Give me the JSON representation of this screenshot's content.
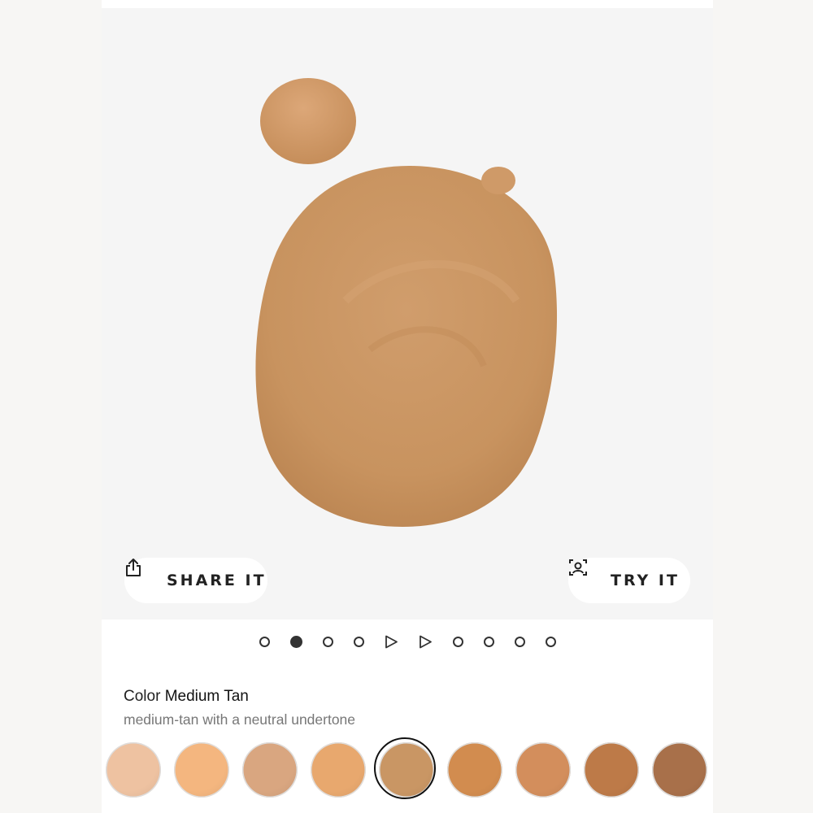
{
  "actions": {
    "share_label": "SHARE IT",
    "try_label": "TRY IT"
  },
  "gallery": {
    "slides": [
      "image",
      "image-active",
      "image",
      "image",
      "video",
      "video",
      "image",
      "image",
      "image",
      "image"
    ],
    "active_index": 1,
    "product_color": "#c99664"
  },
  "product": {
    "color_label": "Color",
    "color_value": "Medium Tan",
    "color_description": "medium-tan with a neutral undertone"
  },
  "swatches": [
    {
      "color": "#eec2a1"
    },
    {
      "color": "#f4b67f"
    },
    {
      "color": "#d9a680"
    },
    {
      "color": "#e8a86e"
    },
    {
      "color": "#c99664",
      "selected": true
    },
    {
      "color": "#d28c4f"
    },
    {
      "color": "#d38e5c"
    },
    {
      "color": "#bd7a48"
    },
    {
      "color": "#a8704a"
    }
  ]
}
